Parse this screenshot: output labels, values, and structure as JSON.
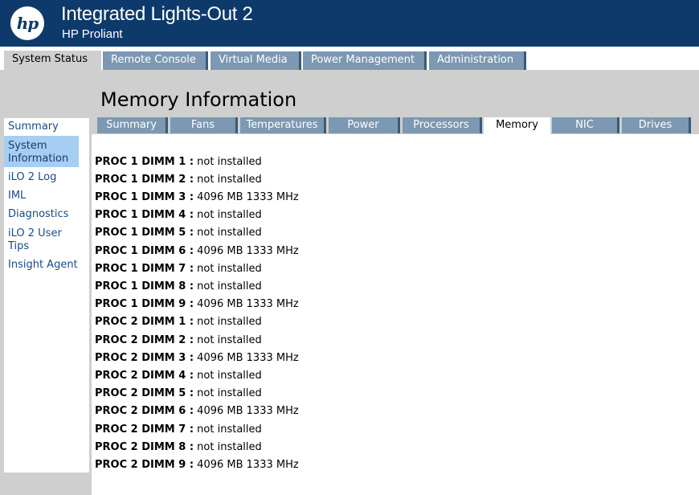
{
  "header": {
    "logo_text": "hp",
    "title": "Integrated Lights-Out 2",
    "subtitle": "HP Proliant"
  },
  "top_tabs": [
    {
      "label": "System Status",
      "active": true
    },
    {
      "label": "Remote Console",
      "active": false
    },
    {
      "label": "Virtual Media",
      "active": false
    },
    {
      "label": "Power Management",
      "active": false
    },
    {
      "label": "Administration",
      "active": false
    }
  ],
  "page_title": "Memory Information",
  "sidebar": {
    "items": [
      {
        "label": "Summary",
        "active": false
      },
      {
        "label": "System Information",
        "active": true
      },
      {
        "label": "iLO 2 Log",
        "active": false
      },
      {
        "label": "IML",
        "active": false
      },
      {
        "label": "Diagnostics",
        "active": false
      },
      {
        "label": "iLO 2 User Tips",
        "active": false
      },
      {
        "label": "Insight Agent",
        "active": false
      }
    ]
  },
  "sub_tabs": [
    {
      "label": "Summary",
      "active": false
    },
    {
      "label": "Fans",
      "active": false
    },
    {
      "label": "Temperatures",
      "active": false
    },
    {
      "label": "Power",
      "active": false
    },
    {
      "label": "Processors",
      "active": false
    },
    {
      "label": "Memory",
      "active": true
    },
    {
      "label": "NIC",
      "active": false
    },
    {
      "label": "Drives",
      "active": false
    }
  ],
  "memory": [
    {
      "label": "PROC 1 DIMM 1 :",
      "value": "not installed"
    },
    {
      "label": "PROC 1 DIMM 2 :",
      "value": "not installed"
    },
    {
      "label": "PROC 1 DIMM 3 :",
      "value": "4096 MB 1333 MHz"
    },
    {
      "label": "PROC 1 DIMM 4 :",
      "value": "not installed"
    },
    {
      "label": "PROC 1 DIMM 5 :",
      "value": "not installed"
    },
    {
      "label": "PROC 1 DIMM 6 :",
      "value": "4096 MB 1333 MHz"
    },
    {
      "label": "PROC 1 DIMM 7 :",
      "value": "not installed"
    },
    {
      "label": "PROC 1 DIMM 8 :",
      "value": "not installed"
    },
    {
      "label": "PROC 1 DIMM 9 :",
      "value": "4096 MB 1333 MHz"
    },
    {
      "label": "PROC 2 DIMM 1 :",
      "value": "not installed"
    },
    {
      "label": "PROC 2 DIMM 2 :",
      "value": "not installed"
    },
    {
      "label": "PROC 2 DIMM 3 :",
      "value": "4096 MB 1333 MHz"
    },
    {
      "label": "PROC 2 DIMM 4 :",
      "value": "not installed"
    },
    {
      "label": "PROC 2 DIMM 5 :",
      "value": "not installed"
    },
    {
      "label": "PROC 2 DIMM 6 :",
      "value": "4096 MB 1333 MHz"
    },
    {
      "label": "PROC 2 DIMM 7 :",
      "value": "not installed"
    },
    {
      "label": "PROC 2 DIMM 8 :",
      "value": "not installed"
    },
    {
      "label": "PROC 2 DIMM 9 :",
      "value": "4096 MB 1333 MHz"
    }
  ],
  "colors": {
    "header_bg": "#0d3a6a",
    "tab_bg": "#7c98b2",
    "band_bg": "#cfcfcf",
    "sidebar_active": "#a6cdf2",
    "link": "#1a4a8a"
  }
}
